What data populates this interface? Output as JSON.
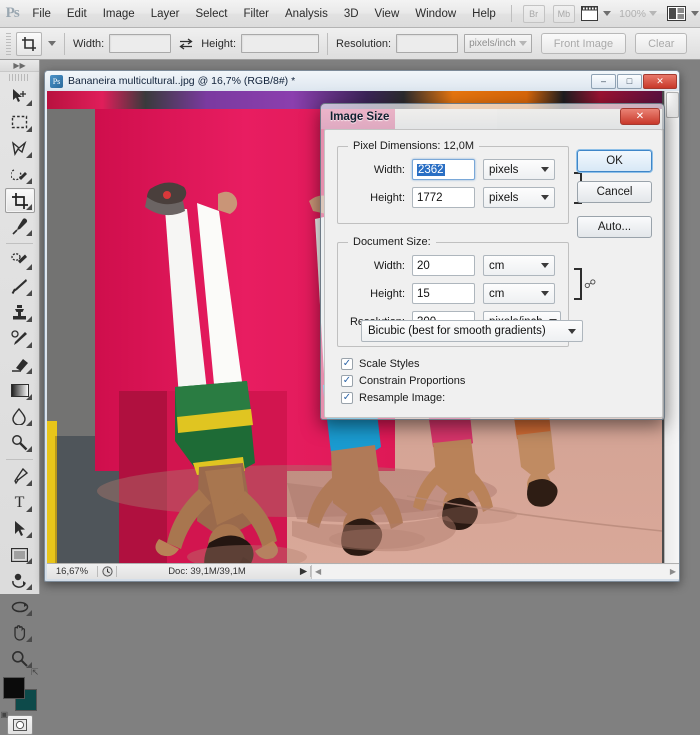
{
  "menubar": {
    "logo": "Ps",
    "items": [
      "File",
      "Edit",
      "Image",
      "Layer",
      "Select",
      "Filter",
      "Analysis",
      "3D",
      "View",
      "Window",
      "Help"
    ],
    "bridge_label": "Br",
    "minibridge_label": "Mb",
    "zoom_level": "100%"
  },
  "optionsbar": {
    "tool_icon": "crop-icon",
    "width_label": "Width:",
    "width_value": "",
    "width_placeholder": "",
    "swap_icon": "swap-arrows-icon",
    "height_label": "Height:",
    "height_value": "",
    "resolution_label": "Resolution:",
    "resolution_value": "",
    "resolution_unit": "pixels/inch",
    "front_image_label": "Front Image",
    "clear_label": "Clear"
  },
  "toolbox": {
    "tools": [
      {
        "name": "move-tool",
        "active": false
      },
      {
        "name": "rectangular-marquee-tool",
        "active": false
      },
      {
        "name": "lasso-tool",
        "active": false
      },
      {
        "name": "quick-selection-tool",
        "active": false
      },
      {
        "name": "crop-tool",
        "active": true
      },
      {
        "name": "eyedropper-tool",
        "active": false
      },
      {
        "name": "spot-healing-brush-tool",
        "active": false
      },
      {
        "name": "brush-tool",
        "active": false
      },
      {
        "name": "clone-stamp-tool",
        "active": false
      },
      {
        "name": "history-brush-tool",
        "active": false
      },
      {
        "name": "eraser-tool",
        "active": false
      },
      {
        "name": "gradient-tool",
        "active": false
      },
      {
        "name": "blur-tool",
        "active": false
      },
      {
        "name": "dodge-tool",
        "active": false
      },
      {
        "name": "pen-tool",
        "active": false
      },
      {
        "name": "horizontal-type-tool",
        "active": false
      },
      {
        "name": "path-selection-tool",
        "active": false
      },
      {
        "name": "rectangle-shape-tool",
        "active": false
      },
      {
        "name": "3d-rotate-tool",
        "active": false
      },
      {
        "name": "3d-orbit-tool",
        "active": false
      },
      {
        "name": "hand-tool",
        "active": false
      },
      {
        "name": "zoom-tool",
        "active": false
      }
    ],
    "type_tool_glyph": "T",
    "foreground_color": "#0b0b0b",
    "background_color": "#0d4a4a"
  },
  "document": {
    "title": "Bananeira multicultural..jpg @ 16,7% (RGB/8#) *",
    "icon_label": "Ps",
    "minimize_label": "–",
    "maximize_label": "□",
    "close_label": "✕",
    "statusbar": {
      "zoom": "16,67%",
      "clock_icon": "clock-icon",
      "doc_info": "Doc: 39,1M/39,1M",
      "arrow_icon": "play-arrow-icon"
    }
  },
  "dialog": {
    "title": "Image Size",
    "close_label": "✕",
    "pixel_dimensions": {
      "legend": "Pixel Dimensions:  12,0M",
      "width_label": "Width:",
      "width_value": "2362",
      "width_unit": "pixels",
      "height_label": "Height:",
      "height_value": "1772",
      "height_unit": "pixels",
      "chain_icon": "chain-link-icon"
    },
    "document_size": {
      "legend": "Document Size:",
      "width_label": "Width:",
      "width_value": "20",
      "width_unit": "cm",
      "height_label": "Height:",
      "height_value": "15",
      "height_unit": "cm",
      "resolution_label": "Resolution:",
      "resolution_value": "300",
      "resolution_unit": "pixels/inch",
      "chain_icon": "chain-link-icon"
    },
    "checkboxes": [
      {
        "label": "Scale Styles",
        "checked": true,
        "name": "scale-styles"
      },
      {
        "label": "Constrain Proportions",
        "checked": true,
        "name": "constrain-proportions"
      },
      {
        "label": "Resample Image:",
        "checked": true,
        "name": "resample-image"
      }
    ],
    "check_glyph": "✓",
    "resample_method": "Bicubic (best for smooth gradients)",
    "buttons": {
      "ok": "OK",
      "cancel": "Cancel",
      "auto": "Auto..."
    }
  }
}
